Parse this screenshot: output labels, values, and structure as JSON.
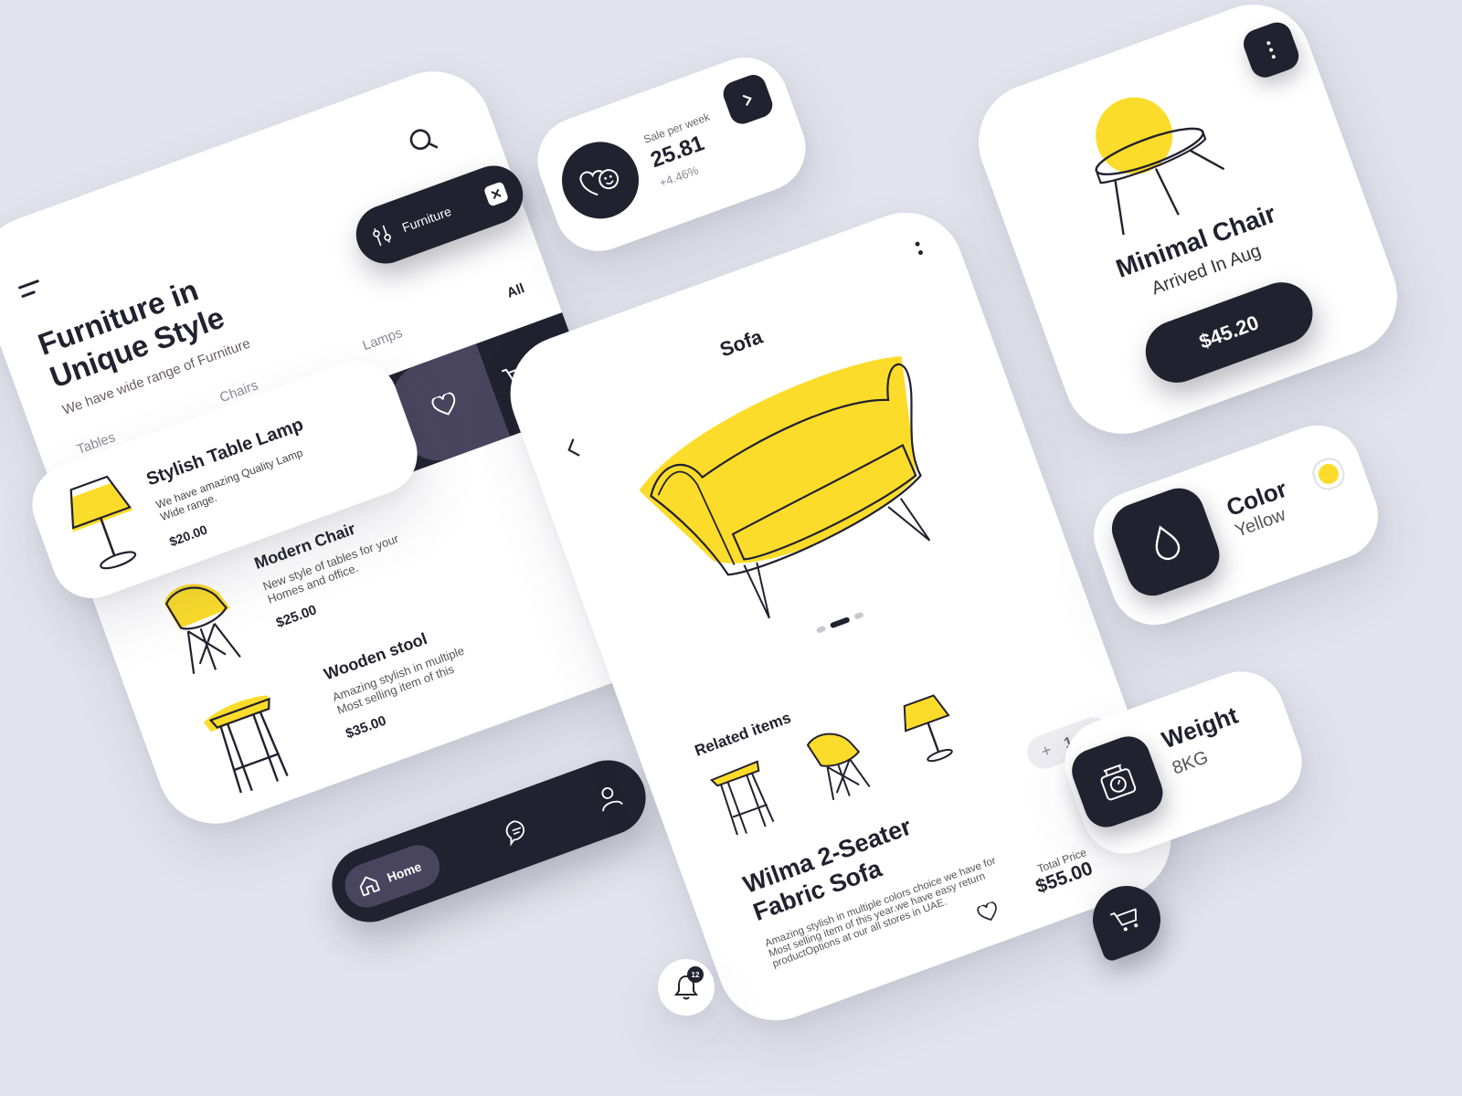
{
  "colors": {
    "accent": "#fcdc2a",
    "dark": "#22212f",
    "muted_purple": "#4a455f",
    "background": "#e2e3ec"
  },
  "home": {
    "title_line1": "Furniture in",
    "title_line2": "Unique Style",
    "subtitle": "We have wide range of Furniture",
    "categories": [
      "All",
      "Lamps",
      "Chairs",
      "Tables"
    ],
    "items": [
      {
        "name": "Modern Chair",
        "desc_line1": "New style of  tables for your",
        "desc_line2": "Homes and office.",
        "price": "$25.00"
      },
      {
        "name": "Wooden stool",
        "desc_line1": "Amazing stylish in multiple",
        "desc_line2": "Most selling item of this",
        "price": "$35.00"
      }
    ],
    "nav": {
      "home_label": "Home"
    }
  },
  "filter_chip": {
    "label": "Furniture"
  },
  "lamp_card": {
    "name": "Stylish Table Lamp",
    "desc_line1": "We have amazing Quality Lamp",
    "desc_line2": "Wide range.",
    "price": "$20.00"
  },
  "sales": {
    "label": "Sale per week",
    "value": "25.81",
    "change": "+4.46%"
  },
  "product": {
    "header": "Sofa",
    "related_title": "Related items",
    "quantity": "1",
    "plus": "+",
    "minus": "−",
    "name_line1": "Wilma 2-Seater",
    "name_line2": "Fabric Sofa",
    "desc_line1": "Amazing stylish in multiple colors choice we have for",
    "desc_line2": "Most selling item of this year.we have easy return",
    "desc_line3": "productOptions at our all stores in UAE.",
    "total_label": "Total Price",
    "total_value": "$55.00"
  },
  "notification": {
    "count": "12"
  },
  "minimal_chair": {
    "name": "Minimal Chair",
    "subtitle": "Arrived In Aug",
    "price": "$45.20"
  },
  "color_card": {
    "title": "Color",
    "value": "Yellow"
  },
  "weight_card": {
    "title": "Weight",
    "value": "8KG"
  }
}
